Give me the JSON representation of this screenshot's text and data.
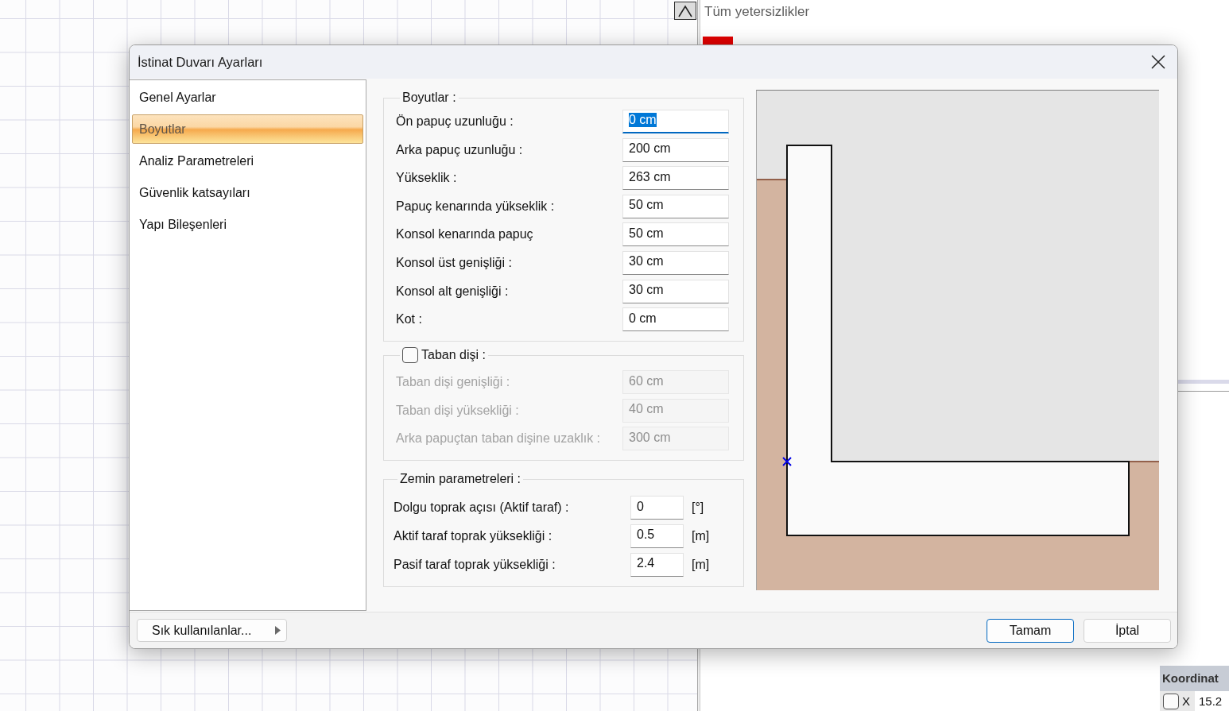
{
  "deficiency_panel": {
    "title": "Tüm yetersizlikler"
  },
  "coordinate_panel": {
    "title": "Koordinat",
    "rows": [
      {
        "label": "X",
        "value": "15.2",
        "checked": false
      }
    ]
  },
  "dialog": {
    "title": "İstinat Duvarı Ayarları",
    "sidebar": {
      "items": [
        {
          "label": "Genel Ayarlar",
          "selected": false
        },
        {
          "label": "Boyutlar",
          "selected": true
        },
        {
          "label": "Analiz Parametreleri",
          "selected": false
        },
        {
          "label": "Güvenlik katsayıları",
          "selected": false
        },
        {
          "label": "Yapı Bileşenleri",
          "selected": false
        }
      ]
    },
    "dimensions": {
      "title": "Boyutlar :",
      "fields": [
        {
          "label": "Ön papuç uzunluğu :",
          "value": "0 cm",
          "focused": true
        },
        {
          "label": "Arka papuç uzunluğu :",
          "value": "200 cm",
          "focused": false
        },
        {
          "label": "Yükseklik :",
          "value": "263 cm",
          "focused": false
        },
        {
          "label": "Papuç kenarında yükseklik :",
          "value": "50 cm",
          "focused": false
        },
        {
          "label": "Konsol kenarında papuç",
          "value": "50 cm",
          "focused": false
        },
        {
          "label": "Konsol üst genişliği :",
          "value": "30 cm",
          "focused": false
        },
        {
          "label": "Konsol alt genişliği :",
          "value": "30 cm",
          "focused": false
        },
        {
          "label": "Kot :",
          "value": "0 cm",
          "focused": false
        }
      ]
    },
    "toe": {
      "title": "Taban dişi :",
      "checked": false,
      "fields": [
        {
          "label": "Taban dişi genişliği :",
          "value": "60 cm",
          "disabled": true
        },
        {
          "label": "Taban dişi yüksekliği :",
          "value": "40 cm",
          "disabled": true
        },
        {
          "label": "Arka papuçtan taban dişine uzaklık :",
          "value": "300 cm",
          "disabled": true
        }
      ]
    },
    "soil": {
      "title": "Zemin parametreleri :",
      "fields": [
        {
          "label": "Dolgu toprak açısı (Aktif taraf) :",
          "value": "0",
          "unit": "[°]"
        },
        {
          "label": "Aktif taraf toprak yüksekliği :",
          "value": "0.5",
          "unit": "[m]"
        },
        {
          "label": "Pasif taraf toprak yüksekliği :",
          "value": "2.4",
          "unit": "[m]"
        }
      ]
    },
    "footer": {
      "favorites": "Sık kullanılanlar...",
      "buttons": [
        {
          "label": "Tamam",
          "default": true
        },
        {
          "label": "İptal",
          "default": false
        }
      ]
    }
  }
}
